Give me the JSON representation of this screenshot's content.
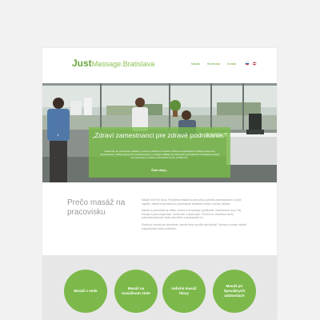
{
  "header": {
    "logo_just": "Just",
    "logo_rest": "Massage.Bratislava",
    "nav": [
      "Masáže",
      "Rezervácia",
      "Kontakt"
    ],
    "flags": [
      "sk-flag",
      "en-flag"
    ]
  },
  "hero": {
    "quote": "„Zdraví zamestnanci pre zdravé podnikanie.“",
    "body": "Vedeli ste, že zdravotné problémy s krčnou chrbticou a bolesti chrbta sú najčastejšou príčinou pracovnej neschopnosti, znižujú výkonnosť zamestnancov a zvyšujú náklady na zdravotnú starostlivosť? Pravidelná masáž na pracovisku pomáha predchádzať týmto problémom.",
    "more_label": "Čítať ďalej...",
    "prev_icon": "chevron-left-icon",
    "next_icon": "chevron-right-icon"
  },
  "about": {
    "title": "Prečo masáž na pracovisku",
    "paragraphs": [
      "Masáž nie je len lúxus. Pravidelná masáž na pracovisku pomáha zamestnancom uvoľniť napätie, zlepšiť koncentráciu a predchádzať bolestiam chrbta a krčnej chrbtice.",
      "Masáž na pracovisku je krátka, účinná a nevyžaduje vyzliekanie. Zamestnanci sa po nej vracajú k práci oddýchnutí, motivovaní a výkonnejší. Pre firmu to znamená menej práceneschopnosti, lepšiu atmosféru a spokojnejší tím.",
      "Služba je vhodná pre kancelárie, menšie firmy aj veľké spoločnosti. Termíny a rozsah masáží prispôsobíme vašim potrebám."
    ]
  },
  "services": [
    {
      "label": "Masáž v sede"
    },
    {
      "label": "Masáž na masážnom stole"
    },
    {
      "label": "Indická masáž hlavy"
    },
    {
      "label": "Masáž pri špeciálnych udalostiach"
    }
  ],
  "colors": {
    "brand_green": "#6aa63b",
    "light_green": "#8bc152",
    "circle_green": "#7cb94a",
    "hero_overlay": "#78be46",
    "page_bg": "#f2f2f2",
    "services_bg": "#e7e7e7"
  }
}
